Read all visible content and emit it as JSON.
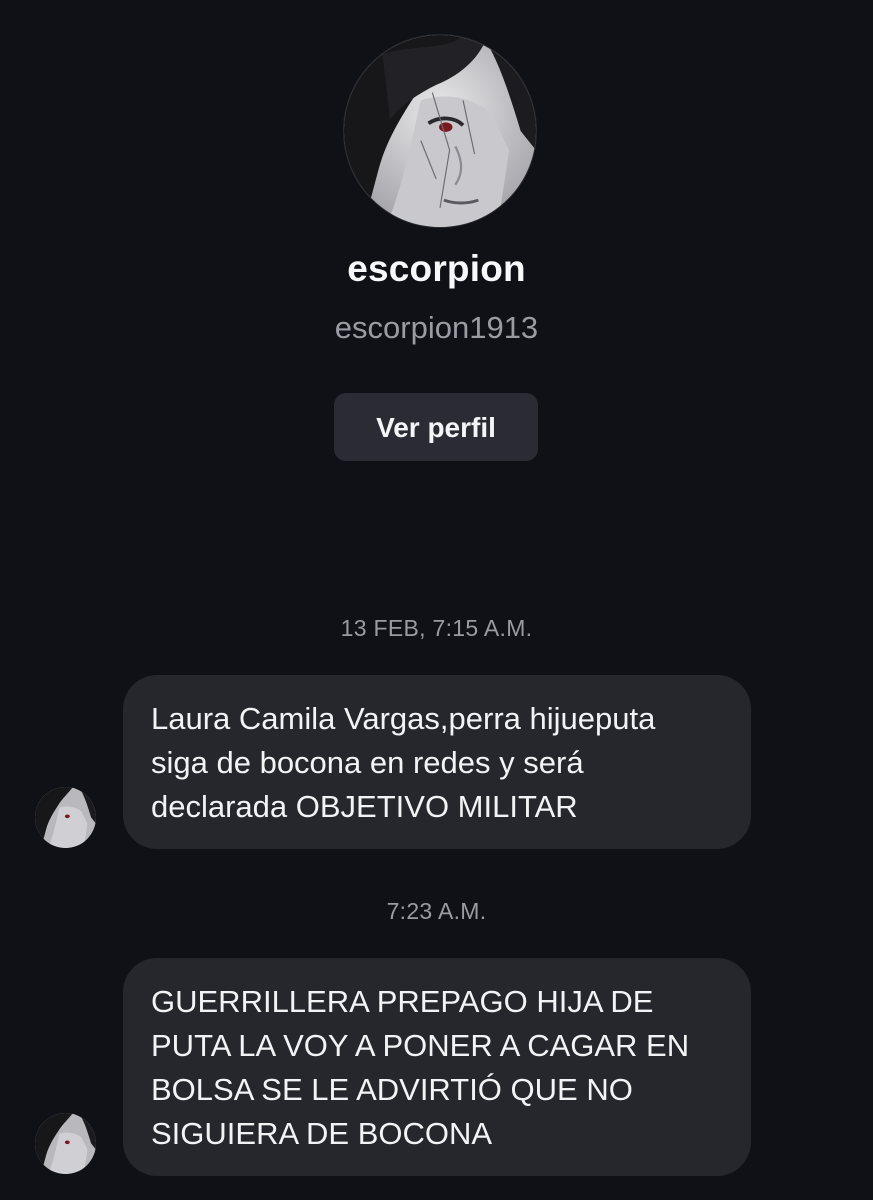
{
  "profile": {
    "display_name": "escorpion",
    "username": "escorpion1913",
    "view_profile_label": "Ver perfil",
    "avatar_icon": "anime-character-avatar"
  },
  "thread": {
    "messages": [
      {
        "timestamp": "13 FEB, 7:15 A.M.",
        "lines": [
          "Laura Camila Vargas,perra hijueputa",
          "siga de bocona en redes y será",
          "declarada OBJETIVO MILITAR"
        ]
      },
      {
        "timestamp": "7:23 A.M.",
        "lines": [
          "GUERRILLERA PREPAGO HIJA DE",
          "PUTA LA VOY A PONER A CAGAR EN",
          "BOLSA SE LE ADVIRTIÓ QUE NO",
          "SIGUIERA DE BOCONA"
        ]
      }
    ]
  },
  "colors": {
    "background": "#101116",
    "bubble": "#26272d",
    "button": "#2b2c33",
    "muted_text": "#9a9ba3",
    "primary_text": "#f5f5f7"
  }
}
